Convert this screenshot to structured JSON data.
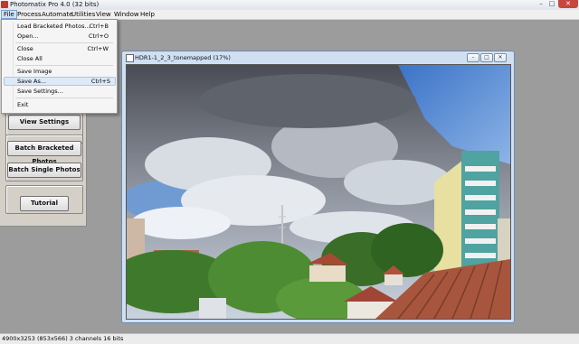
{
  "window": {
    "title": "Photomatix Pro 4.0 (32 bits)",
    "controls": {
      "minimize": "–",
      "maximize": "□",
      "close": "✕"
    }
  },
  "menubar": {
    "items": [
      "File",
      "Process",
      "Automate",
      "Utilities",
      "View",
      "Window",
      "Help"
    ]
  },
  "file_menu": {
    "items": [
      {
        "label": "Load Bracketed Photos...",
        "shortcut": "Ctrl+B"
      },
      {
        "label": "Open...",
        "shortcut": "Ctrl+O"
      },
      {
        "label": "Close",
        "shortcut": "Ctrl+W"
      },
      {
        "label": "Close All",
        "shortcut": ""
      },
      {
        "label": "Save Image",
        "shortcut": ""
      },
      {
        "label": "Save As...",
        "shortcut": "Ctrl+S"
      },
      {
        "label": "Save Settings...",
        "shortcut": ""
      },
      {
        "label": "Exit",
        "shortcut": ""
      }
    ],
    "highlighted": "Save As..."
  },
  "left_panel": {
    "buttons": [
      "View Settings",
      "Batch Bracketed Photos",
      "Batch Single Photos",
      "Tutorial"
    ]
  },
  "image_window": {
    "title": "HDR1-1_2_3_tonemapped (17%)",
    "controls": {
      "minimize": "–",
      "maximize": "□",
      "close": "✕"
    }
  },
  "statusbar": {
    "text": "4900x3253 (853x566) 3 channels 16 bits"
  },
  "colors": {
    "menu_highlight": "#dce9f8",
    "panel_bg": "#d4d0c8",
    "workspace_bg": "#9c9c9c",
    "close_button": "#c7473d"
  }
}
